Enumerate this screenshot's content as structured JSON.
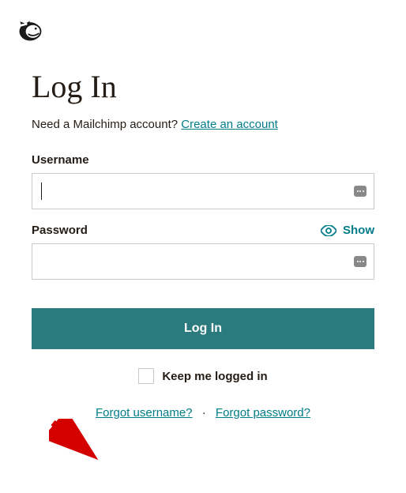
{
  "page": {
    "title": "Log In",
    "prompt_text": "Need a Mailchimp account? ",
    "create_account_link": "Create an account"
  },
  "fields": {
    "username_label": "Username",
    "username_value": "",
    "password_label": "Password",
    "password_value": "",
    "show_label": "Show"
  },
  "buttons": {
    "login": "Log In"
  },
  "keep_logged": {
    "label": "Keep me logged in"
  },
  "forgot": {
    "username": "Forgot username?",
    "password": "Forgot password?",
    "separator": "·"
  }
}
